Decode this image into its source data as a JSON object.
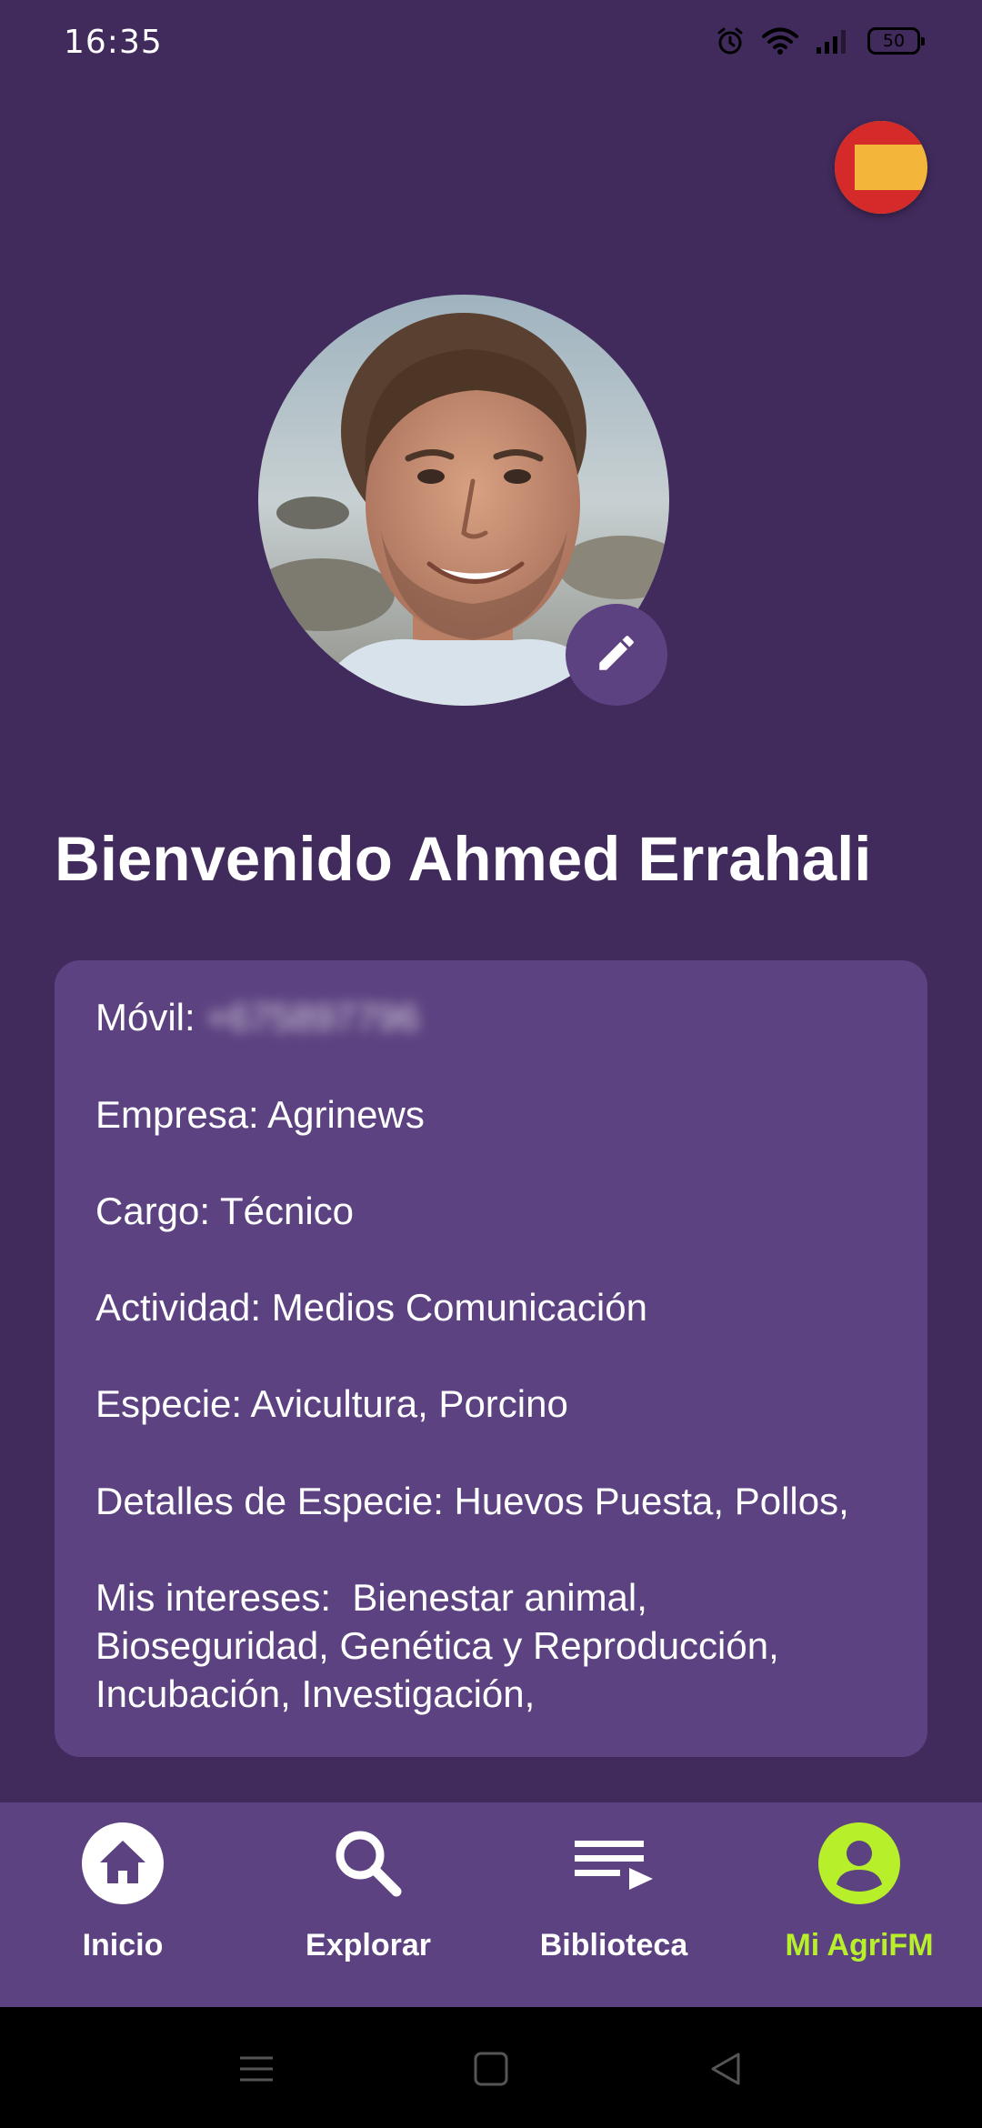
{
  "status_bar": {
    "time": "16:35",
    "battery_level": "50",
    "icons": [
      "alarm-icon",
      "wifi-icon",
      "signal-icon",
      "battery-icon"
    ]
  },
  "language": {
    "flag": "spain-flag-icon"
  },
  "profile": {
    "welcome": "Bienvenido Ahmed Errahali",
    "edit_icon": "pencil-icon"
  },
  "info": {
    "mobile_label": "Móvil:",
    "mobile_value": "+675897796",
    "company": "Empresa: Agrinews",
    "position": "Cargo: Técnico",
    "activity": "Actividad: Medios Comunicación",
    "species": "Especie: Avicultura, Porcino",
    "species_details": "Detalles de Especie: Huevos Puesta, Pollos,",
    "interests_line1": "Mis intereses:  Bienestar animal,",
    "interests_line2": "Bioseguridad, Genética y Reproducción,",
    "interests_line3": "Incubación, Investigación,"
  },
  "bottom_nav": {
    "items": [
      {
        "label": "Inicio",
        "icon": "home-icon",
        "active": false
      },
      {
        "label": "Explorar",
        "icon": "search-icon",
        "active": false
      },
      {
        "label": "Biblioteca",
        "icon": "playlist-icon",
        "active": false
      },
      {
        "label": "Mi AgriFM",
        "icon": "account-icon",
        "active": true
      }
    ]
  },
  "colors": {
    "background": "#412A5C",
    "card": "#5C4280",
    "active_accent": "#B7F02A",
    "text": "#FFFFFF"
  },
  "system_nav": {
    "icons": [
      "menu-icon",
      "home-square-icon",
      "back-triangle-icon"
    ]
  }
}
